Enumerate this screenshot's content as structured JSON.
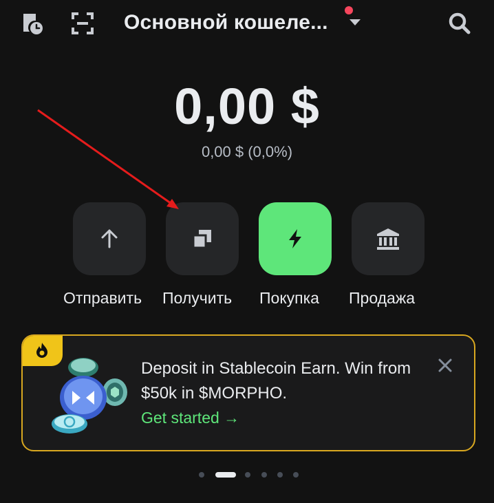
{
  "header": {
    "wallet_name": "Основной кошеле...",
    "history_icon": "history-clock-icon",
    "scan_icon": "scan-frame-icon",
    "search_icon": "search-icon"
  },
  "balance": {
    "total": "0,00 $",
    "change": "0,00 $ (0,0%)"
  },
  "actions": [
    {
      "label": "Отправить",
      "icon": "arrow-up-icon"
    },
    {
      "label": "Получить",
      "icon": "receive-copy-icon"
    },
    {
      "label": "Покупка",
      "icon": "lightning-icon"
    },
    {
      "label": "Продажа",
      "icon": "bank-icon"
    }
  ],
  "banner": {
    "text": "Deposit in Stablecoin Earn. Win from $50k in $MORPHO.",
    "cta": "Get started →"
  },
  "carousel": {
    "count": 6,
    "active_index": 1
  },
  "colors": {
    "background": "#121212",
    "accent_green": "#5ee67a",
    "banner_border": "#d9a820",
    "annotation_arrow": "#e51c1c"
  }
}
